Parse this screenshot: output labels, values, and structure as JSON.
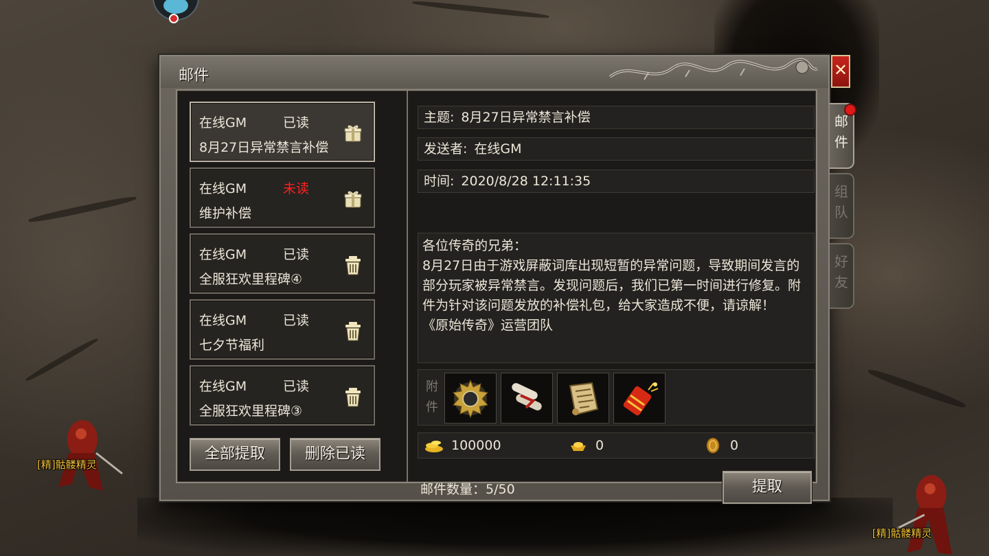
{
  "window": {
    "title": "邮件"
  },
  "close_label": "✕",
  "mail_list": [
    {
      "sender": "在线GM",
      "status": "已读",
      "subject": "8月27日异常禁言补偿",
      "unread": false,
      "icon": "gift-box-icon"
    },
    {
      "sender": "在线GM",
      "status": "未读",
      "subject": "维护补偿",
      "unread": true,
      "icon": "gift-box-icon"
    },
    {
      "sender": "在线GM",
      "status": "已读",
      "subject": "全服狂欢里程碑④",
      "unread": false,
      "icon": "trash-icon"
    },
    {
      "sender": "在线GM",
      "status": "已读",
      "subject": "七夕节福利",
      "unread": false,
      "icon": "trash-icon"
    },
    {
      "sender": "在线GM",
      "status": "已读",
      "subject": "全服狂欢里程碑③",
      "unread": false,
      "icon": "trash-icon"
    }
  ],
  "buttons": {
    "claim_all": "全部提取",
    "delete_read": "删除已读",
    "claim": "提取"
  },
  "detail": {
    "subject_label": "主题:",
    "subject": "8月27日异常禁言补偿",
    "sender_label": "发送者:",
    "sender": "在线GM",
    "time_label": "时间:",
    "time": "2020/8/28 12:11:35",
    "body": "各位传奇的兄弟：\n8月27日由于游戏屏蔽词库出现短暂的异常问题，导致期间发言的部分玩家被异常禁言。发现问题后，我们已第一时间进行修复。附件为针对该问题发放的补偿礼包，给大家造成不便，请谅解！\n《原始传奇》运营团队",
    "attach_label": "附件",
    "attachments": [
      "gear-emblem-icon",
      "scroll-bundle-icon",
      "skill-book-icon",
      "firecracker-icon"
    ],
    "gold": "100000",
    "ingot": "0",
    "coin": "0"
  },
  "mail_count": "邮件数量：5/50",
  "side_tabs": [
    {
      "label": "邮件",
      "active": true
    },
    {
      "label": "组队",
      "active": false
    },
    {
      "label": "好友",
      "active": false
    }
  ],
  "world": {
    "monster_label": "[精]骷髅精灵"
  },
  "colors": {
    "unread": "#ff2020",
    "label_gold": "#f2c23a",
    "close_red": "#c8241c"
  }
}
